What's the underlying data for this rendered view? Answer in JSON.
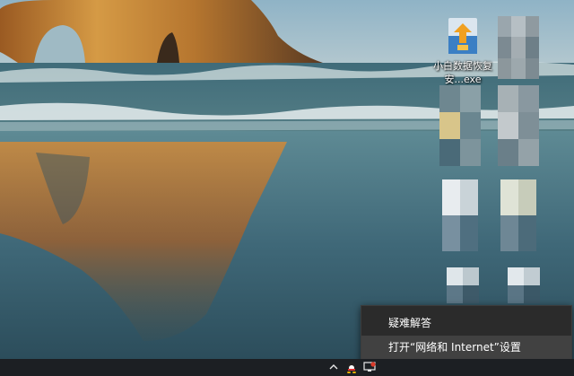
{
  "desktop": {
    "icons": [
      {
        "name": "xiaobai-recovery",
        "label_line1": "小白数据恢复",
        "label_line2": "安...exe"
      }
    ]
  },
  "context_menu": {
    "items": [
      {
        "label": "疑难解答"
      },
      {
        "label": "打开“网络和 Internet”设置",
        "highlighted": true
      }
    ]
  },
  "taskbar": {
    "tray_icons": [
      "chevron-up-icon",
      "qq-icon",
      "network-icon"
    ]
  },
  "colors": {
    "menu_bg": "#2b2b2b",
    "menu_hover": "#414141",
    "taskbar_bg": "#1c1f23",
    "sky": "#7fa3b5",
    "rock": "#b8792f",
    "sea": "#3d6b7a"
  }
}
